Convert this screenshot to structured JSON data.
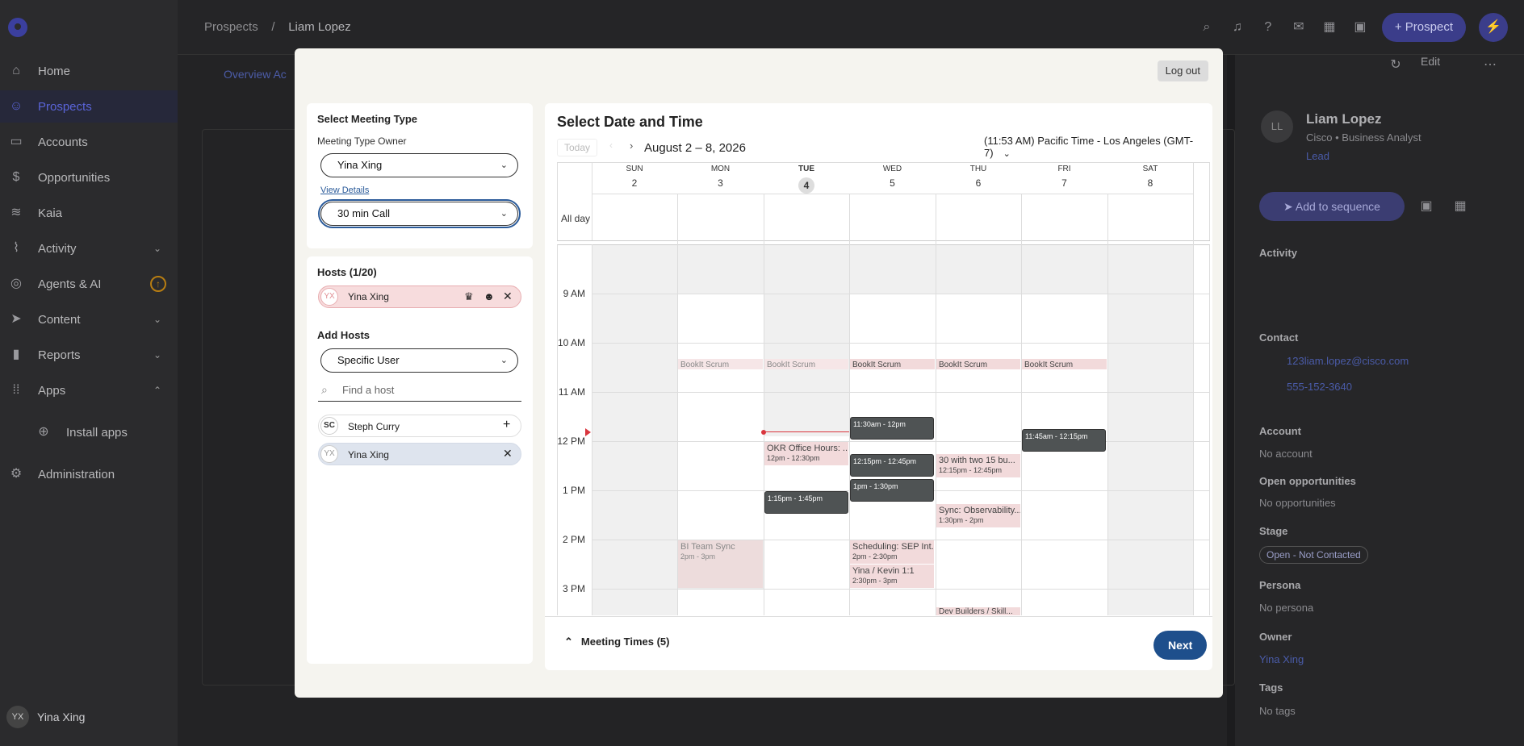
{
  "breadcrumb": {
    "root": "Prospects",
    "sep": "/",
    "current": "Liam Lopez"
  },
  "topbar": {
    "prospect_btn": "+ Prospect"
  },
  "nav": [
    {
      "label": "Home",
      "icon": "home-icon"
    },
    {
      "label": "Prospects",
      "icon": "person-icon",
      "active": true
    },
    {
      "label": "Accounts",
      "icon": "briefcase-icon"
    },
    {
      "label": "Opportunities",
      "icon": "dollar-icon"
    },
    {
      "label": "Kaia",
      "icon": "waveform-icon"
    },
    {
      "label": "Activity",
      "icon": "activity-icon"
    },
    {
      "label": "Agents & AI",
      "icon": "agent-icon"
    },
    {
      "label": "Content",
      "icon": "send-icon"
    },
    {
      "label": "Reports",
      "icon": "bars-icon"
    },
    {
      "label": "Apps",
      "icon": "grid-icon"
    },
    {
      "label": "Install apps",
      "icon": "plus-circle-icon"
    },
    {
      "label": "Administration",
      "icon": "gear-icon"
    }
  ],
  "user": {
    "initials": "YX",
    "name": "Yina Xing"
  },
  "bg": {
    "tabs": "Overview   Ac"
  },
  "right": {
    "initials": "LL",
    "name": "Liam Lopez",
    "subtitle": "Cisco • Business Analyst",
    "lead": "Lead",
    "add_seq": "Add to sequence",
    "edit": "Edit",
    "activity": "Activity",
    "contact": "Contact",
    "email": "123liam.lopez@cisco.com",
    "phone": "555-152-3640",
    "account": "Account",
    "no_account": "No account",
    "open_opps": "Open opportunities",
    "no_opps": "No opportunities",
    "stage": "Stage",
    "stage_val": "Open - Not Contacted",
    "persona": "Persona",
    "no_persona": "No persona",
    "owner": "Owner",
    "owner_val": "Yina Xing",
    "tags": "Tags",
    "no_tags": "No tags"
  },
  "modal": {
    "logout": "Log out",
    "meeting": {
      "title": "Select Meeting Type",
      "owner_label": "Meeting Type Owner",
      "owner_value": "Yina Xing",
      "view_details": "View Details",
      "type_value": "30 min Call"
    },
    "hosts": {
      "title": "Hosts (1/20)",
      "host_initials": "YX",
      "host_name": "Yina Xing",
      "add_title": "Add Hosts",
      "filter_value": "Specific User",
      "search_placeholder": "Find a host",
      "users": [
        {
          "initials": "SC",
          "name": "Steph Curry"
        },
        {
          "initials": "YX",
          "name": "Yina Xing"
        }
      ]
    },
    "calendar": {
      "title": "Select Date and Time",
      "today": "Today",
      "range": "August 2 – 8, 2026",
      "timezone": "(11:53 AM) Pacific Time - Los Angeles (GMT-7)",
      "all_day": "All day",
      "days": [
        {
          "dow": "SUN",
          "num": "2"
        },
        {
          "dow": "MON",
          "num": "3"
        },
        {
          "dow": "TUE",
          "num": "4"
        },
        {
          "dow": "WED",
          "num": "5"
        },
        {
          "dow": "THU",
          "num": "6"
        },
        {
          "dow": "FRI",
          "num": "7"
        },
        {
          "dow": "SAT",
          "num": "8"
        }
      ],
      "times": [
        "9 AM",
        "10 AM",
        "11 AM",
        "12 PM",
        "1 PM",
        "2 PM",
        "3 PM"
      ],
      "events": {
        "mon_scrum": "BookIt Scrum",
        "tue_scrum": "BookIt Scrum",
        "wed_scrum": "BookIt Scrum",
        "thu_scrum": "BookIt Scrum",
        "fri_scrum": "BookIt Scrum",
        "wed_1130": "11:30am - 12pm",
        "fri_1145": "11:45am - 12:15pm",
        "tue_okr": "OKR Office Hours: ...",
        "tue_okr_t": "12pm - 12:30pm",
        "wed_1215": "12:15pm - 12:45pm",
        "thu_30": "30 with two 15 bu...",
        "thu_30_t": "12:15pm - 12:45pm",
        "tue_115": "1:15pm - 1:45pm",
        "wed_1pm": "1pm - 1:30pm",
        "thu_sync": "Sync: Observability...",
        "thu_sync_t": "1:30pm - 2pm",
        "mon_bi": "BI Team Sync",
        "mon_bi_t": "2pm - 3pm",
        "wed_sched": "Scheduling: SEP Int...",
        "wed_sched_t": "2pm - 2:30pm",
        "wed_yina": "Yina / Kevin 1:1",
        "wed_yina_t": "2:30pm - 3pm",
        "thu_dev": "Dev Builders / Skill..."
      },
      "meeting_times": "Meeting Times (5)",
      "next": "Next"
    }
  }
}
